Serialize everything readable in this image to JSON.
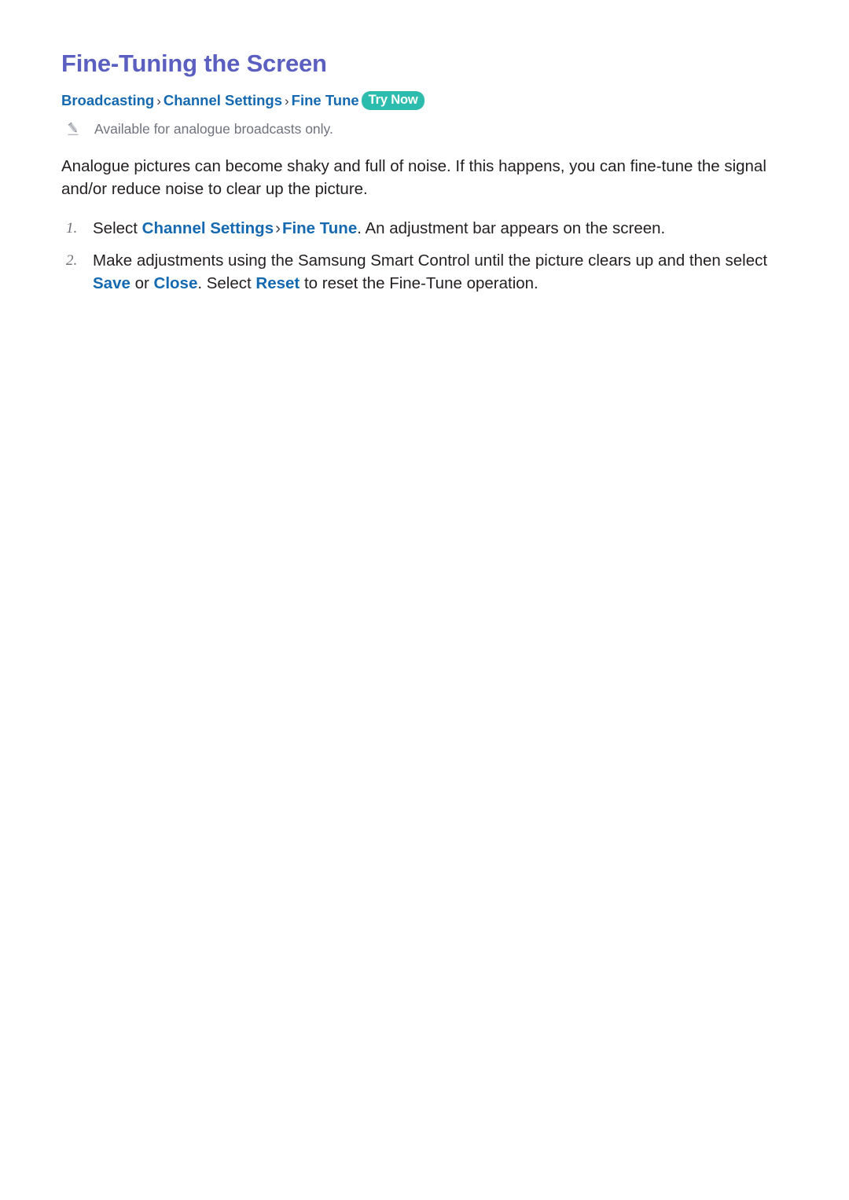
{
  "document": {
    "title": "Fine-Tuning the Screen",
    "title_color": "#5b5fc0",
    "background_color": "#ffffff",
    "body_text_color": "#231f20"
  },
  "breadcrumb": {
    "items": [
      "Broadcasting",
      "Channel Settings",
      "Fine Tune"
    ],
    "separator": "›",
    "link_color": "#1569b0",
    "badge": {
      "label": "Try Now",
      "background_color": "#2bbcae",
      "text_color": "#ffffff"
    }
  },
  "note": {
    "icon": "pencil-icon",
    "text": "Available for analogue broadcasts only.",
    "text_color": "#70737e"
  },
  "intro": {
    "paragraph": "Analogue pictures can become shaky and full of noise. If this happens, you can fine-tune the signal and/or reduce noise to clear up the picture."
  },
  "steps": [
    {
      "marker": "1.",
      "prefix": "Select ",
      "link1": "Channel Settings",
      "separator": "›",
      "link2": "Fine Tune",
      "suffix": ". An adjustment bar appears on the screen."
    },
    {
      "marker": "2.",
      "line1": "Make adjustments using the Samsung Smart Control until the picture clears up and then select",
      "save_label": "Save",
      "or_text": " or ",
      "close_label": "Close",
      "mid_text": ". Select ",
      "reset_label": "Reset",
      "tail_text": " to reset the Fine-Tune operation."
    }
  ]
}
